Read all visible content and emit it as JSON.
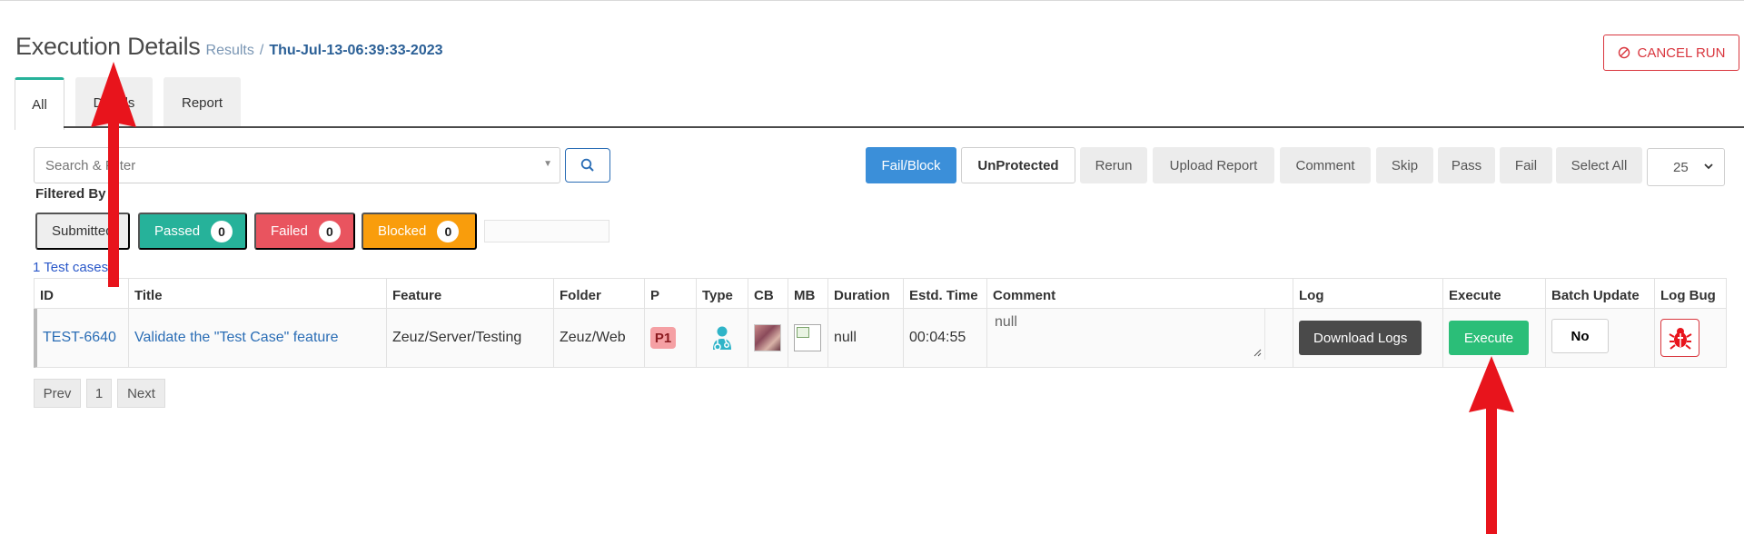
{
  "header": {
    "title": "Execution Details",
    "breadcrumb_parent": "Results",
    "breadcrumb_separator": "/",
    "breadcrumb_current": "Thu-Jul-13-06:39:33-2023",
    "cancel_label": "CANCEL RUN"
  },
  "tabs": [
    {
      "label": "All",
      "active": true
    },
    {
      "label": "Details",
      "active": false
    },
    {
      "label": "Report",
      "active": false
    }
  ],
  "search": {
    "placeholder": "Search & Filter"
  },
  "actions": {
    "fail_block": "Fail/Block",
    "unprotected": "UnProtected",
    "rerun": "Rerun",
    "upload_report": "Upload Report",
    "comment": "Comment",
    "skip": "Skip",
    "pass": "Pass",
    "fail": "Fail",
    "select_all": "Select All",
    "page_size": "25"
  },
  "filters": {
    "label": "Filtered By",
    "submitted": "Submitted",
    "passed": {
      "label": "Passed",
      "count": "0"
    },
    "failed": {
      "label": "Failed",
      "count": "0"
    },
    "blocked": {
      "label": "Blocked",
      "count": "0"
    }
  },
  "test_count": "1 Test cases",
  "table": {
    "headers": {
      "id": "ID",
      "title": "Title",
      "feature": "Feature",
      "folder": "Folder",
      "p": "P",
      "type": "Type",
      "cb": "CB",
      "mb": "MB",
      "duration": "Duration",
      "estd": "Estd. Time",
      "comment": "Comment",
      "log": "Log",
      "execute": "Execute",
      "batch": "Batch Update",
      "bug": "Log Bug"
    },
    "rows": [
      {
        "id": "TEST-6640",
        "title": "Validate the \"Test Case\" feature",
        "feature": "Zeuz/Server/Testing",
        "folder": "Zeuz/Web",
        "priority": "P1",
        "duration": "null",
        "estd_time": "00:04:55",
        "comment": "null",
        "log_button": "Download Logs",
        "execute_button": "Execute",
        "batch_value": "No"
      }
    ]
  },
  "pagination": {
    "prev": "Prev",
    "page": "1",
    "next": "Next"
  },
  "colors": {
    "accent_teal": "#26b29a",
    "danger": "#d9363e",
    "primary": "#3b8fd9",
    "failed": "#e9545f",
    "blocked": "#f99d0c",
    "execute_green": "#2bbe78",
    "annotation_red": "#e8141c"
  },
  "icons": {
    "cancel": "ban-icon",
    "search": "search-icon",
    "page_size": "chevron-down-icon",
    "type": "doctor-icon",
    "bug": "bug-icon"
  }
}
